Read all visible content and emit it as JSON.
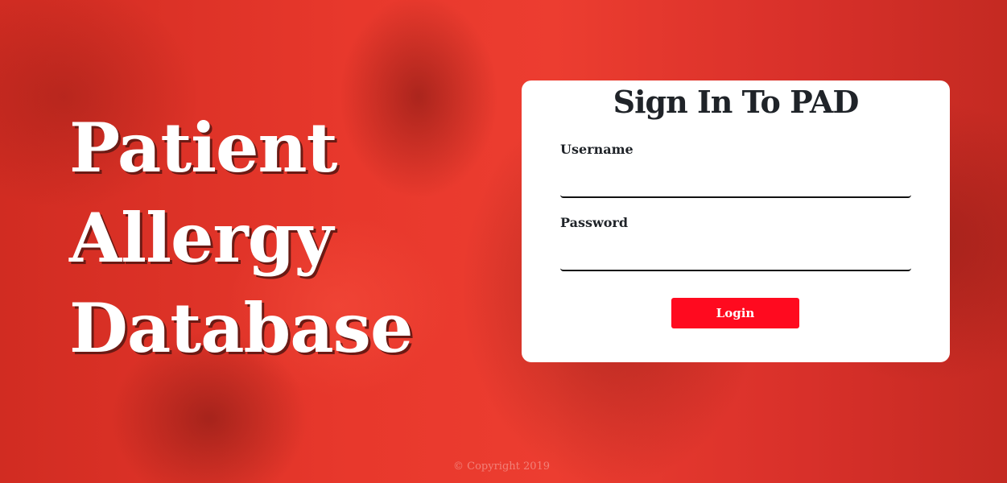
{
  "hero": {
    "title_lines": [
      "Patient",
      "Allergy",
      "Database"
    ]
  },
  "login": {
    "title": "Sign In To PAD",
    "username_label": "Username",
    "username_value": "",
    "password_label": "Password",
    "password_value": "",
    "button_label": "Login"
  },
  "footer": {
    "copyright": "© Copyright 2019"
  },
  "colors": {
    "background": "#e8362b",
    "button": "#ff0a1f",
    "card": "#ffffff",
    "text_dark": "#1f2328"
  }
}
